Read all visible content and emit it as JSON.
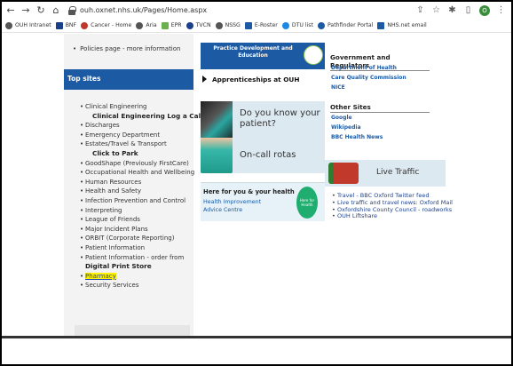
{
  "browser": {
    "url": "ouh.oxnet.nhs.uk/Pages/Home.aspx",
    "profile_initial": "O"
  },
  "bookmarks": [
    {
      "label": "OUH Intranet",
      "color": "#555555"
    },
    {
      "label": "BNF",
      "color": "#1c3f8c"
    },
    {
      "label": "Cancer - Home",
      "color": "#c0392b"
    },
    {
      "label": "Aria",
      "color": "#555555"
    },
    {
      "label": "EPR",
      "color": "#6ab04c"
    },
    {
      "label": "TVCN",
      "color": "#1c3f8c"
    },
    {
      "label": "NSSG",
      "color": "#555555"
    },
    {
      "label": "E-Roster",
      "color": "#1c5aa3"
    },
    {
      "label": "DTU list",
      "color": "#1e88e5"
    },
    {
      "label": "Pathfinder Portal",
      "color": "#1c5aa3"
    },
    {
      "label": "NHS.net email",
      "color": "#1c5aa3"
    }
  ],
  "left": {
    "policies_link": "Policies page - more information",
    "top_sites_heading": "Top sites",
    "sites": [
      {
        "text": "Clinical Engineering",
        "kind": "link"
      },
      {
        "text": "Clinical Engineering Log a Call",
        "kind": "sub"
      },
      {
        "text": "Discharges",
        "kind": "link"
      },
      {
        "text": "Emergency Department",
        "kind": "link"
      },
      {
        "text": "Estates/Travel & Transport",
        "kind": "link"
      },
      {
        "text": "Click to Park",
        "kind": "sub"
      },
      {
        "text": "GoodShape (Previously FirstCare)",
        "kind": "link"
      },
      {
        "text": "Occupational Health and Wellbeing",
        "kind": "link"
      },
      {
        "text": "Human Resources",
        "kind": "link"
      },
      {
        "text": "Health and Safety",
        "kind": "link"
      },
      {
        "text": "Infection Prevention and Control",
        "kind": "link"
      },
      {
        "text": "Interpreting",
        "kind": "link"
      },
      {
        "text": "League of Friends",
        "kind": "link"
      },
      {
        "text": "Major Incident Plans",
        "kind": "link"
      },
      {
        "text": "ORBIT (Corporate Reporting)",
        "kind": "link"
      },
      {
        "text": "Patient Information",
        "kind": "link"
      },
      {
        "text": "Patient Information - order from",
        "kind": "link"
      },
      {
        "text": "Digital Print Store",
        "kind": "subplain"
      },
      {
        "text": "Pharmacy",
        "kind": "highlight"
      },
      {
        "text": "Security Services",
        "kind": "link"
      }
    ]
  },
  "middle": {
    "practice_banner": "Practice Development and Education",
    "apprenticeships": "Apprenticeships at OUH",
    "know_patient": "Do you know your patient?",
    "oncall": "On-call rotas",
    "here_for_you": "Here for you & your health",
    "hic_line1": "Health Improvement",
    "hic_line2": "Advice Centre",
    "badge_text": "Here for Health"
  },
  "right": {
    "gov_heading": "Government and Regulators",
    "gov_links": [
      "Department of Health",
      "Care Quality Commission",
      "NICE"
    ],
    "other_heading": "Other Sites",
    "other_links": [
      "Google",
      "Wikipedia",
      "BBC Health News"
    ],
    "live_traffic": "Live Traffic",
    "traffic_links": [
      "Travel - BBC Oxford Twitter feed",
      "Live traffic and travel news: Oxford Mail",
      "Oxfordshire County Council - roadworks",
      "OUH Liftshare"
    ]
  }
}
